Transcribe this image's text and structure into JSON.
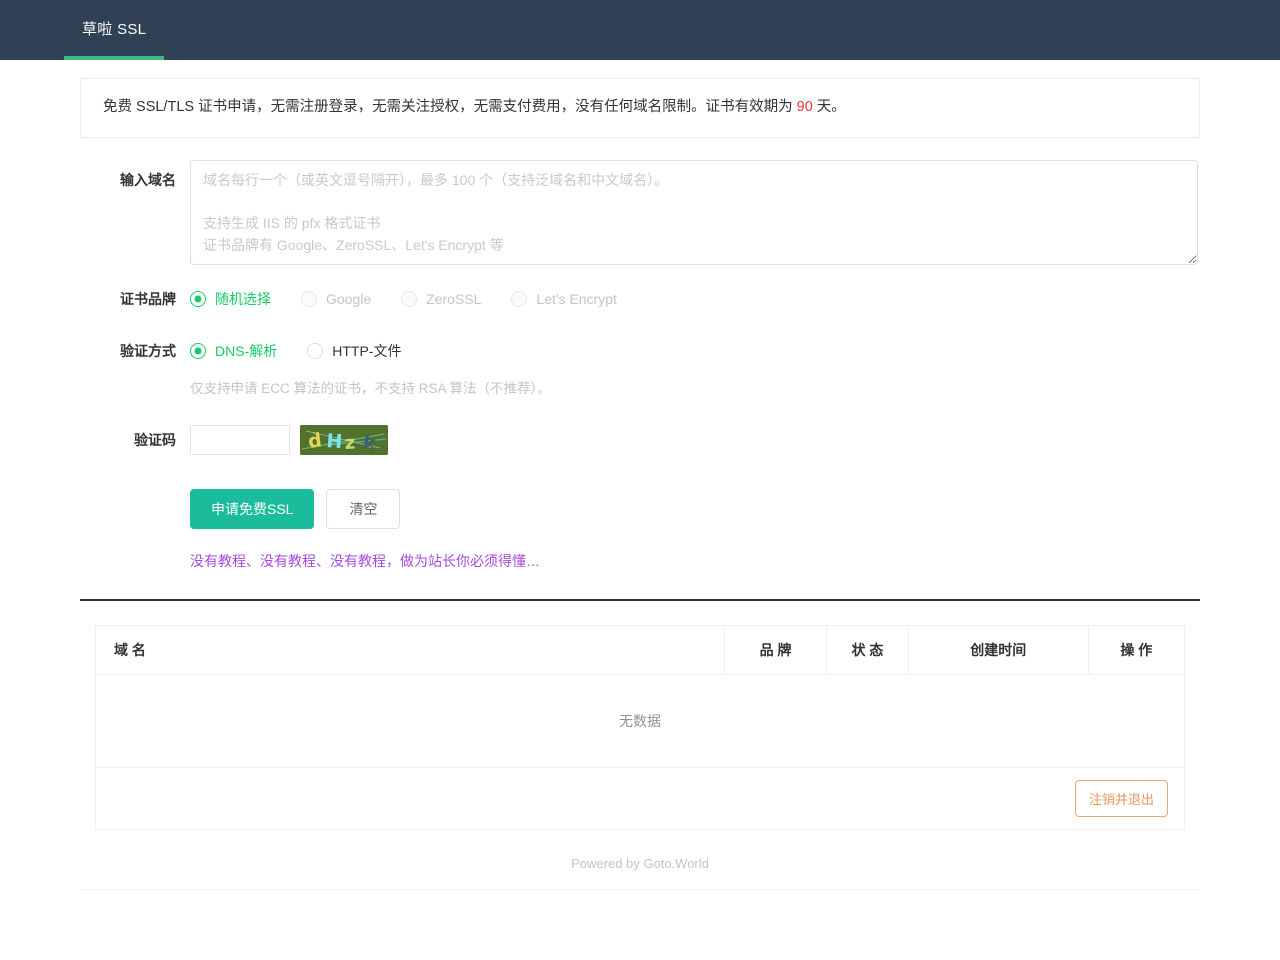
{
  "navbar": {
    "brand": "草啦 SSL",
    "accent_color": "#42b983",
    "background_color": "#304156"
  },
  "alert": {
    "text_before": "免费 SSL/TLS 证书申请，无需注册登录，无需关注授权，无需支付费用，没有任何域名限制。证书有效期为 ",
    "highlight": "90",
    "text_after": " 天。",
    "highlight_color": "#e4393c"
  },
  "form": {
    "domain": {
      "label": "输入域名",
      "value": "",
      "placeholder": "域名每行一个（或英文逗号隔开），最多 100 个（支持泛域名和中文域名）。\n\n支持生成 IIS 的 pfx 格式证书\n证书品牌有 Google、ZeroSSL、Let's Encrypt 等"
    },
    "brand": {
      "label": "证书品牌",
      "selected": "随机选择",
      "options": [
        {
          "label": "随机选择",
          "checked": true,
          "disabled": false
        },
        {
          "label": "Google",
          "checked": false,
          "disabled": true
        },
        {
          "label": "ZeroSSL",
          "checked": false,
          "disabled": true
        },
        {
          "label": "Let's Encrypt",
          "checked": false,
          "disabled": true
        }
      ]
    },
    "verify": {
      "label": "验证方式",
      "selected": "DNS-解析",
      "options": [
        {
          "label": "DNS-解析",
          "checked": true,
          "disabled": false
        },
        {
          "label": "HTTP-文件",
          "checked": false,
          "disabled": false
        }
      ],
      "hint": "仅支持申请 ECC 算法的证书，不支持 RSA 算法（不推荐）。"
    },
    "captcha": {
      "label": "验证码",
      "value": "",
      "image_text": "dHzk",
      "chars": [
        "d",
        "H",
        "z",
        "k"
      ]
    },
    "buttons": {
      "submit": "申请免费SSL",
      "clear": "清空",
      "submit_color": "#1abc9c"
    },
    "tutorial_link": {
      "text": "没有教程、没有教程、没有教程，做为站长你必须得懂…",
      "color": "#a64ae0"
    }
  },
  "table": {
    "columns": [
      {
        "key": "domain",
        "label": "域 名"
      },
      {
        "key": "brand",
        "label": "品 牌"
      },
      {
        "key": "status",
        "label": "状 态"
      },
      {
        "key": "created",
        "label": "创建时间"
      },
      {
        "key": "action",
        "label": "操 作"
      }
    ],
    "rows": [],
    "empty_text": "无数据",
    "logout_button": "注销并退出",
    "logout_color": "#e8975a"
  },
  "footer": {
    "text": "Powered by Goto.World"
  }
}
